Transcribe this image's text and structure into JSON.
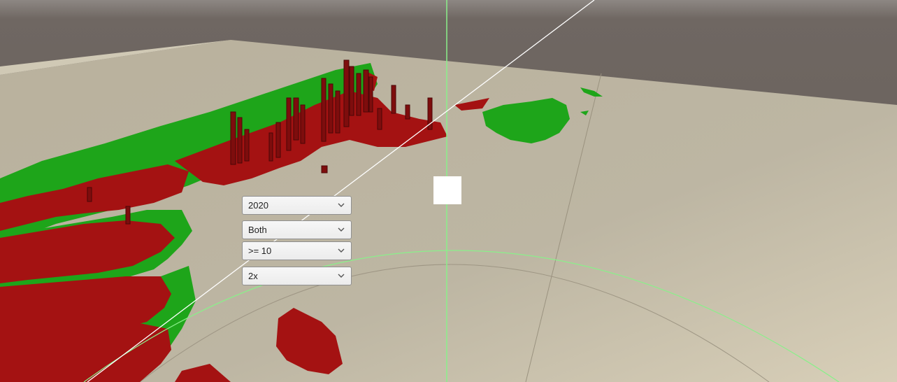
{
  "scene": {
    "colors": {
      "sky": "#6a625d",
      "ground": "#bfb7a3",
      "positive": "#1ea51a",
      "negative": "#a41212",
      "axis_green": "#8af08a",
      "line_white": "#ffffff"
    }
  },
  "controls": {
    "year": {
      "value": "2020",
      "icon": "chevron-down-icon"
    },
    "mode": {
      "value": "Both",
      "icon": "chevron-down-icon"
    },
    "threshold": {
      "value": ">= 10",
      "icon": "chevron-down-icon"
    },
    "scale": {
      "value": "2x",
      "icon": "chevron-down-icon"
    }
  }
}
